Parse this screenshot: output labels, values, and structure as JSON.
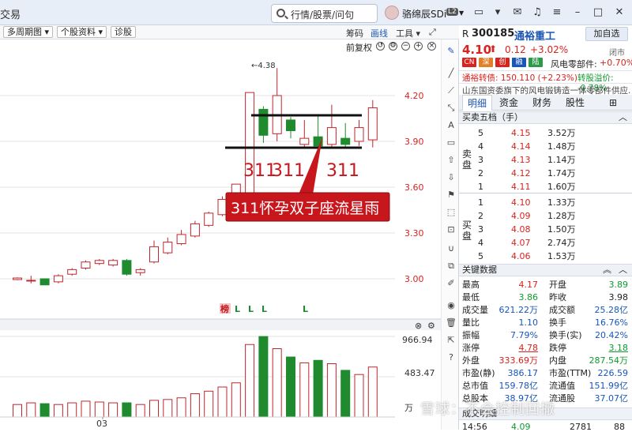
{
  "topbar": {
    "title_fragment": "交易",
    "search_placeholder": "行情/股票/问句",
    "username": "骆绵辰SDi",
    "level_badge": "L2"
  },
  "toolbar": {
    "period": "多周期图",
    "stock_info": "个股资料",
    "diagnose": "诊股",
    "chips": "筹码",
    "draw": "画线",
    "tools": "工具",
    "adjust": "前复权"
  },
  "chart": {
    "price_ticks": [
      "4.20",
      "3.90",
      "3.60",
      "3.30",
      "3.00"
    ],
    "peak_label": "←4.38",
    "volume_ticks": [
      "966.94",
      "483.47",
      "万"
    ],
    "date_label": "03",
    "markers": [
      "榜",
      "L",
      "L",
      "L",
      "L"
    ],
    "annotation_numbers": [
      "311",
      "311",
      "311"
    ],
    "annotation_box": "311怀孕双子座流星雨",
    "candles": [
      {
        "o": 2.995,
        "c": 3.005,
        "h": 3.01,
        "l": 2.99,
        "up": true
      },
      {
        "o": 2.985,
        "c": 2.99,
        "h": 3.02,
        "l": 2.97,
        "up": true
      },
      {
        "o": 3.0,
        "c": 2.96,
        "h": 3.0,
        "l": 2.96,
        "up": false
      },
      {
        "o": 2.98,
        "c": 3.02,
        "h": 3.03,
        "l": 2.97,
        "up": true
      },
      {
        "o": 3.03,
        "c": 3.06,
        "h": 3.07,
        "l": 3.02,
        "up": true
      },
      {
        "o": 3.07,
        "c": 3.11,
        "h": 3.12,
        "l": 3.06,
        "up": true
      },
      {
        "o": 3.1,
        "c": 3.12,
        "h": 3.13,
        "l": 3.09,
        "up": true
      },
      {
        "o": 3.09,
        "c": 3.12,
        "h": 3.13,
        "l": 3.08,
        "up": true
      },
      {
        "o": 3.12,
        "c": 3.03,
        "h": 3.13,
        "l": 3.02,
        "up": false
      },
      {
        "o": 3.04,
        "c": 3.06,
        "h": 3.07,
        "l": 3.02,
        "up": true
      },
      {
        "o": 3.11,
        "c": 3.21,
        "h": 3.25,
        "l": 3.1,
        "up": true
      },
      {
        "o": 3.17,
        "c": 3.24,
        "h": 3.27,
        "l": 3.16,
        "up": true
      },
      {
        "o": 3.23,
        "c": 3.29,
        "h": 3.32,
        "l": 3.22,
        "up": true
      },
      {
        "o": 3.28,
        "c": 3.36,
        "h": 3.38,
        "l": 3.27,
        "up": true
      },
      {
        "o": 3.35,
        "c": 3.43,
        "h": 3.44,
        "l": 3.34,
        "up": true
      },
      {
        "o": 3.42,
        "c": 3.52,
        "h": 3.54,
        "l": 3.41,
        "up": true
      },
      {
        "o": 3.52,
        "c": 3.62,
        "h": 3.62,
        "l": 3.51,
        "up": true
      },
      {
        "o": 3.52,
        "c": 4.22,
        "h": 4.22,
        "l": 3.52,
        "up": true
      },
      {
        "o": 4.11,
        "c": 3.94,
        "h": 4.13,
        "l": 3.89,
        "up": false
      },
      {
        "o": 3.95,
        "c": 4.2,
        "h": 4.38,
        "l": 3.9,
        "up": true
      },
      {
        "o": 4.04,
        "c": 3.97,
        "h": 4.06,
        "l": 3.92,
        "up": false
      },
      {
        "o": 3.88,
        "c": 3.92,
        "h": 4.04,
        "l": 3.86,
        "up": true
      },
      {
        "o": 3.93,
        "c": 3.87,
        "h": 4.07,
        "l": 3.86,
        "up": false
      },
      {
        "o": 3.88,
        "c": 3.99,
        "h": 4.14,
        "l": 3.86,
        "up": true
      },
      {
        "o": 3.92,
        "c": 3.88,
        "h": 4.02,
        "l": 3.86,
        "up": false
      },
      {
        "o": 3.9,
        "c": 3.99,
        "h": 4.04,
        "l": 3.87,
        "up": true
      },
      {
        "o": 3.91,
        "c": 4.12,
        "h": 4.17,
        "l": 3.86,
        "up": true
      }
    ],
    "volumes": [
      {
        "v": 150,
        "up": true
      },
      {
        "v": 170,
        "up": true
      },
      {
        "v": 160,
        "up": false
      },
      {
        "v": 150,
        "up": true
      },
      {
        "v": 170,
        "up": true
      },
      {
        "v": 190,
        "up": true
      },
      {
        "v": 180,
        "up": true
      },
      {
        "v": 170,
        "up": true
      },
      {
        "v": 170,
        "up": false
      },
      {
        "v": 150,
        "up": true
      },
      {
        "v": 200,
        "up": true
      },
      {
        "v": 210,
        "up": true
      },
      {
        "v": 230,
        "up": true
      },
      {
        "v": 280,
        "up": true
      },
      {
        "v": 310,
        "up": true
      },
      {
        "v": 360,
        "up": true
      },
      {
        "v": 410,
        "up": true
      },
      {
        "v": 870,
        "up": true
      },
      {
        "v": 966,
        "up": false
      },
      {
        "v": 820,
        "up": true
      },
      {
        "v": 720,
        "up": false
      },
      {
        "v": 650,
        "up": true
      },
      {
        "v": 680,
        "up": false
      },
      {
        "v": 640,
        "up": true
      },
      {
        "v": 560,
        "up": false
      },
      {
        "v": 510,
        "up": true
      },
      {
        "v": 600,
        "up": true
      }
    ]
  },
  "quote": {
    "market": "R",
    "code": "300185",
    "name": "通裕重工",
    "add_button": "加自选",
    "price": "4.10",
    "change": "0.12",
    "pct": "+3.02%",
    "status": "闭市",
    "tags": [
      "CN",
      "深",
      "创",
      "融",
      "陆"
    ],
    "sector_label": "风电零部件:",
    "sector_pct": "+0.70%",
    "bond": "通裕转债: 150.110 (+2.23%)",
    "premium": "转股溢价: -0.78%",
    "desc": "山东国资委旗下的风电锻铸造一体零部件供应..."
  },
  "tabs": [
    "明细",
    "资金",
    "财务",
    "股性"
  ],
  "orderbook": {
    "header": "买卖五档（手）",
    "sell_label": "卖盘",
    "buy_label": "买盘",
    "sell": [
      {
        "n": "5",
        "p": "4.15",
        "v": "3.52万"
      },
      {
        "n": "4",
        "p": "4.14",
        "v": "1.48万"
      },
      {
        "n": "3",
        "p": "4.13",
        "v": "1.14万"
      },
      {
        "n": "2",
        "p": "4.12",
        "v": "1.74万"
      },
      {
        "n": "1",
        "p": "4.11",
        "v": "1.60万"
      }
    ],
    "buy": [
      {
        "n": "1",
        "p": "4.10",
        "v": "1.33万"
      },
      {
        "n": "2",
        "p": "4.09",
        "v": "1.28万"
      },
      {
        "n": "3",
        "p": "4.08",
        "v": "1.50万"
      },
      {
        "n": "4",
        "p": "4.07",
        "v": "2.74万"
      },
      {
        "n": "5",
        "p": "4.06",
        "v": "1.53万"
      }
    ]
  },
  "keydata": {
    "header": "关键数据",
    "rows": [
      [
        "最高",
        "4.17",
        "开盘",
        "3.89"
      ],
      [
        "最低",
        "3.86",
        "昨收",
        "3.98"
      ],
      [
        "成交量",
        "621.22万",
        "成交额",
        "25.28亿"
      ],
      [
        "量比",
        "1.10",
        "换手",
        "16.76%"
      ],
      [
        "振幅",
        "7.79%",
        "换手(实)",
        "20.42%"
      ],
      [
        "涨停",
        "4.78",
        "跌停",
        "3.18"
      ],
      [
        "外盘",
        "333.69万",
        "内盘",
        "287.54万"
      ],
      [
        "市盈(静)",
        "386.17",
        "市盈(TTM)",
        "226.59"
      ],
      [
        "总市值",
        "159.78亿",
        "流通值",
        "151.99亿"
      ],
      [
        "总股本",
        "38.97亿",
        "流通股",
        "37.07亿"
      ]
    ]
  },
  "ticks": {
    "header": "成交明细",
    "time": "14:56",
    "price": "4.09",
    "vol": "2781",
    "n": "88"
  },
  "watermark": "雪球：不会控制回撤"
}
